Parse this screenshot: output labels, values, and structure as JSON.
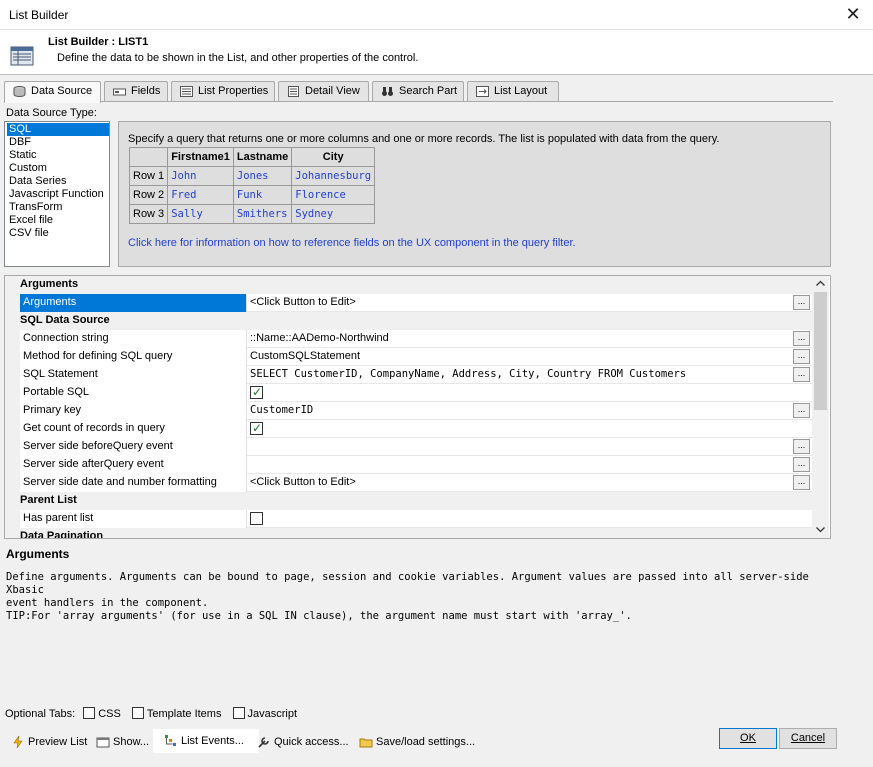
{
  "window": {
    "title": "List Builder",
    "close": "✕"
  },
  "header": {
    "title": "List Builder : LIST1",
    "subtitle": "Define the data to be shown in the List, and other properties of the control."
  },
  "tabs": [
    {
      "label": "Data Source",
      "icon": "database-icon",
      "active": true
    },
    {
      "label": "Fields",
      "icon": "fields-icon"
    },
    {
      "label": "List Properties",
      "icon": "properties-icon"
    },
    {
      "label": "Detail View",
      "icon": "detail-view-icon"
    },
    {
      "label": "Search Part",
      "icon": "binoculars-icon"
    },
    {
      "label": "List Layout",
      "icon": "layout-icon"
    }
  ],
  "data_source": {
    "label": "Data Source Type:",
    "items": [
      "SQL",
      "DBF",
      "Static",
      "Custom",
      "Data Series",
      "Javascript Function",
      "TransForm",
      "Excel file",
      "CSV file"
    ],
    "selected": "SQL"
  },
  "info": {
    "text": "Specify a query that returns one or more columns and one or more records. The list is populated with data from the query.",
    "table": {
      "headers": [
        "",
        "Firstname1",
        "Lastname",
        "City"
      ],
      "rows": [
        [
          "Row 1",
          "John",
          "Jones",
          "Johannesburg"
        ],
        [
          "Row 2",
          "Fred",
          "Funk",
          "Florence"
        ],
        [
          "Row 3",
          "Sally",
          "Smithers",
          "Sydney"
        ]
      ]
    },
    "link": "Click here for information on how to reference fields on the UX component in the query filter."
  },
  "grid": {
    "cat_arguments": "Arguments",
    "arguments": {
      "name": "Arguments",
      "value": "<Click Button to Edit>"
    },
    "cat_sql": "SQL Data Source",
    "connection": {
      "name": "Connection string",
      "value": "::Name::AADemo-Northwind"
    },
    "method": {
      "name": "Method for defining SQL query",
      "value": "CustomSQLStatement"
    },
    "sql": {
      "name": "SQL Statement",
      "value": "SELECT CustomerID, CompanyName, Address, City, Country FROM Customers"
    },
    "portable": {
      "name": "Portable SQL",
      "checked": true
    },
    "pk": {
      "name": "Primary key",
      "value": "CustomerID"
    },
    "count": {
      "name": "Get count of records in query",
      "checked": true
    },
    "before": {
      "name": "Server side beforeQuery event",
      "value": ""
    },
    "after": {
      "name": "Server side afterQuery event",
      "value": ""
    },
    "formatting": {
      "name": "Server side date and number formatting",
      "value": "<Click Button to Edit>"
    },
    "cat_parent": "Parent List",
    "parent": {
      "name": "Has parent list",
      "checked": false
    },
    "cat_pagination": "Data Pagination",
    "btn": "..."
  },
  "description": {
    "title": "Arguments",
    "body": "Define arguments. Arguments can be bound to page, session and cookie variables. Argument values are passed into all server-side Xbasic\nevent handlers in the component.\nTIP:For 'array arguments' (for use in a SQL IN clause), the argument name must start with 'array_'."
  },
  "optional_tabs": {
    "label": "Optional Tabs:",
    "css": "CSS",
    "template": "Template Items",
    "js": "Javascript"
  },
  "toolbar": {
    "preview": "Preview List",
    "show": "Show...",
    "events": "List Events...",
    "quick": "Quick access...",
    "save": "Save/load settings..."
  },
  "buttons": {
    "ok": "OK",
    "cancel": "Cancel"
  }
}
